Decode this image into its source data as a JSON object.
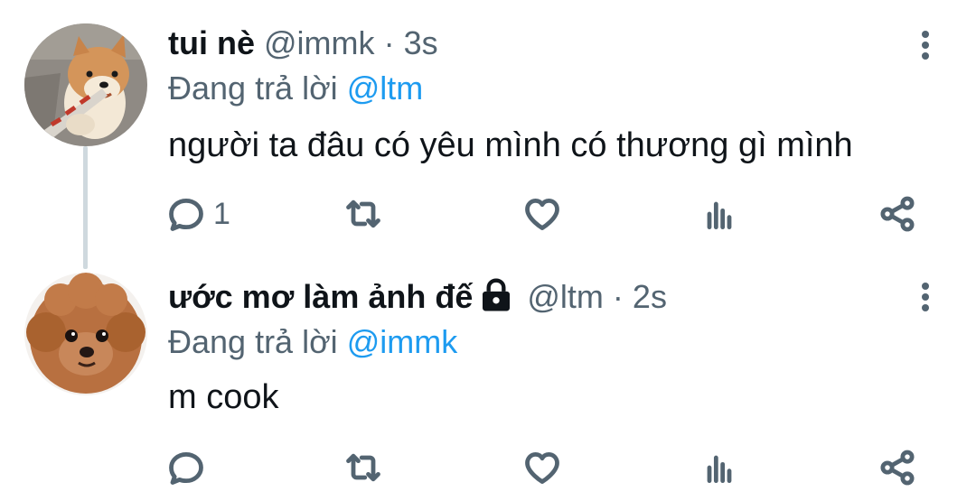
{
  "tweets": [
    {
      "display_name": "tui nè",
      "handle": "@immk",
      "separator": "·",
      "time": "3s",
      "reply_prefix": "Đang trả lời ",
      "reply_mention": "@ltm",
      "text": "người ta đâu có yêu mình có thương gì mình",
      "reply_count": "1",
      "locked": false,
      "avatar": "shiba-dog-photo"
    },
    {
      "display_name": "ước mơ làm ảnh đế",
      "handle": "@ltm",
      "separator": "·",
      "time": "2s",
      "reply_prefix": "Đang trả lời ",
      "reply_mention": "@immk",
      "text": "m cook",
      "reply_count": "",
      "locked": true,
      "avatar": "poodle-dog-photo"
    }
  ],
  "icons": {
    "reply": "reply-icon",
    "retweet": "retweet-icon",
    "like": "heart-icon",
    "stats": "stats-icon",
    "share": "share-icon",
    "more": "more-vertical-icon",
    "lock": "lock-icon"
  },
  "colors": {
    "text": "#0f1419",
    "secondary": "#536471",
    "link": "#1d9bf0",
    "thread_line": "#cfd9de"
  }
}
